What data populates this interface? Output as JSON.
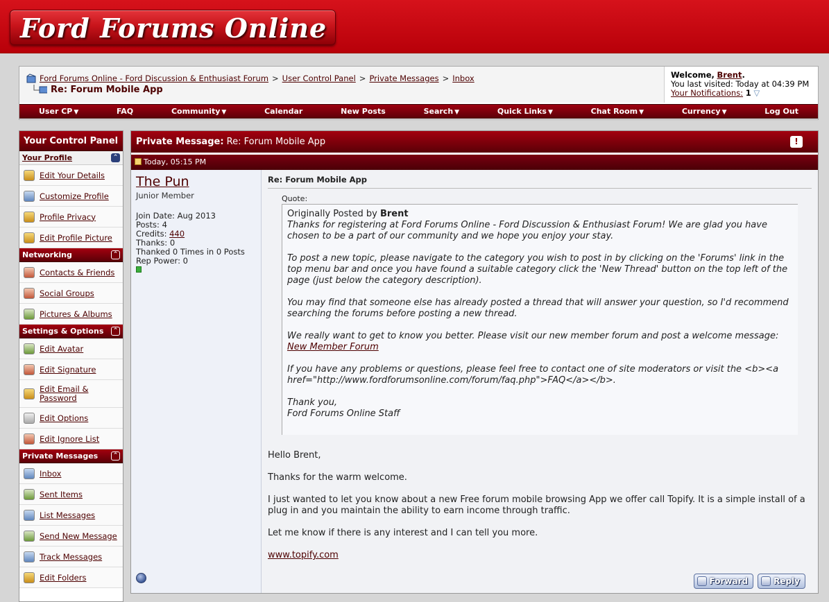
{
  "site": {
    "logo_text": "Ford Forums Online"
  },
  "breadcrumb": {
    "items": [
      "Ford Forums Online - Ford Discussion & Enthusiast Forum",
      "User Control Panel",
      "Private Messages",
      "Inbox"
    ],
    "separator": ">",
    "current": "Re: Forum Mobile App"
  },
  "welcome": {
    "prefix": "Welcome,",
    "username": "Brent",
    "suffix": ".",
    "last_visit": "You last visited: Today at 04:39 PM",
    "notifications_label": "Your Notifications:",
    "notifications_count": "1"
  },
  "navbar": {
    "items": [
      "User CP",
      "FAQ",
      "Community",
      "Calendar",
      "New Posts",
      "Search",
      "Quick Links",
      "Chat Room",
      "Currency",
      "Log Out"
    ]
  },
  "sidebar": {
    "title": "Your Control Panel",
    "sections": [
      {
        "title": "Your Profile",
        "items": [
          "Edit Your Details",
          "Customize Profile",
          "Profile Privacy",
          "Edit Profile Picture"
        ]
      },
      {
        "title": "Networking",
        "items": [
          "Contacts & Friends",
          "Social Groups",
          "Pictures & Albums"
        ]
      },
      {
        "title": "Settings & Options",
        "items": [
          "Edit Avatar",
          "Edit Signature",
          "Edit Email & Password",
          "Edit Options",
          "Edit Ignore List"
        ]
      },
      {
        "title": "Private Messages",
        "items": [
          "Inbox",
          "Sent Items",
          "List Messages",
          "Send New Message",
          "Track Messages",
          "Edit Folders"
        ]
      }
    ]
  },
  "message": {
    "header_label": "Private Message",
    "header_title": "Re: Forum Mobile App",
    "date": "Today, 05:15 PM",
    "author": {
      "name": "The Pun",
      "title": "Junior Member",
      "join_date": "Join Date: Aug 2013",
      "posts": "Posts: 4",
      "credits_label": "Credits:",
      "credits_value": "440",
      "thanks": "Thanks: 0",
      "thanked": "Thanked 0 Times in 0 Posts",
      "rep_power": "Rep Power: 0"
    },
    "title": "Re: Forum Mobile App",
    "quote_label": "Quote:",
    "quote_origin_prefix": "Originally Posted by",
    "quote_author": "Brent",
    "quote_paragraphs": [
      "Thanks for registering at Ford Forums Online - Ford Discussion & Enthusiast Forum! We are glad you have chosen to be a part of our community and we hope you enjoy your stay.",
      "To post a new topic, please navigate to the category you wish to post in by clicking on the 'Forums' link in the top menu bar and once you have found a suitable category click the 'New Thread' button on the top left of the page (just below the category description).",
      "You may find that someone else has already posted a thread that will answer your question, so I'd recommend searching the forums before posting a new thread.",
      "We really want to get to know you better. Please visit our new member forum and post a welcome message:",
      "If you have any problems or questions, please feel free to contact one of site moderators or visit the <b><a href=\"http://www.fordforumsonline.com/forum/faq.php\">FAQ</a></b>."
    ],
    "quote_link": "New Member Forum",
    "quote_signoff_1": "Thank you,",
    "quote_signoff_2": "Ford Forums Online Staff",
    "body": [
      "Hello Brent,",
      "Thanks for the warm welcome.",
      "I just wanted to let you know about a new Free forum mobile browsing App we offer call Topify. It is a simple install of a plug in and you maintain the ability to earn income through traffic.",
      "Let me know if there is any interest and I can tell you more."
    ],
    "link": "www.topify.com",
    "forward_label": "Forward",
    "reply_label": "Reply"
  }
}
